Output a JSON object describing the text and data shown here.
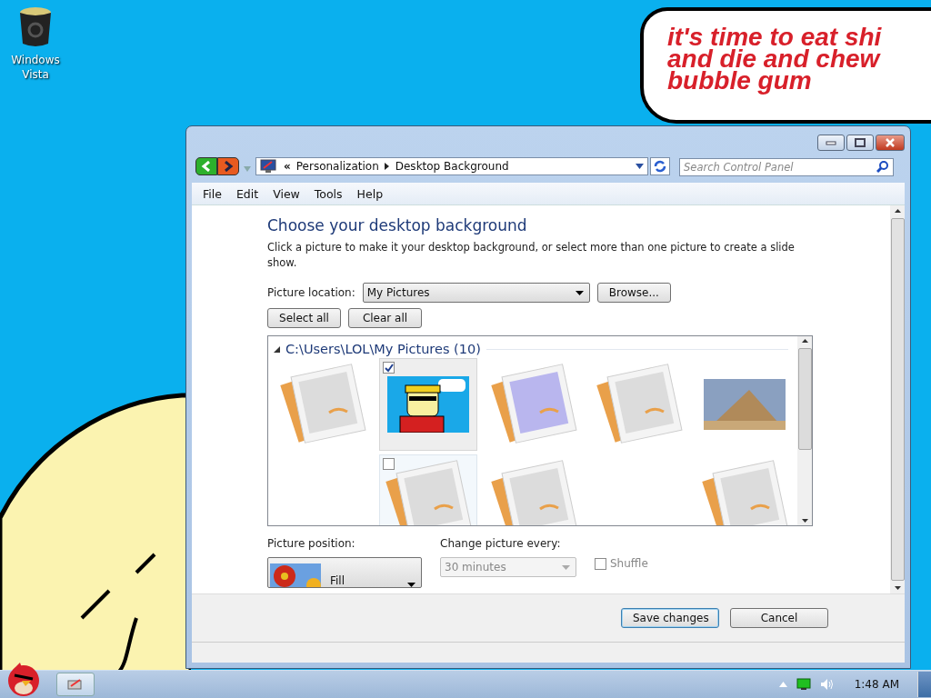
{
  "desktop": {
    "icons": [
      {
        "label": "Windows Vista"
      }
    ],
    "wallpaper_text": [
      "it's time to eat shi",
      "and die and chew",
      "bubble gum"
    ]
  },
  "window": {
    "nav": {
      "breadcrumb": [
        "Personalization",
        "Desktop Background"
      ],
      "separator": "«",
      "search": {
        "placeholder": "Search Control Panel"
      }
    },
    "menu": [
      "File",
      "Edit",
      "View",
      "Tools",
      "Help"
    ],
    "heading": "Choose your desktop background",
    "description": "Click a picture to make it your desktop background, or select more than one picture to create a slide show.",
    "location": {
      "label": "Picture location:",
      "value": "My Pictures",
      "browse": "Browse..."
    },
    "buttons": [
      "Select all",
      "Clear all"
    ],
    "gallery": {
      "group": "C:\\Users\\LOL\\My Pictures (10)",
      "pictures": [
        {
          "kind": "generic",
          "checked": false,
          "hovered": false
        },
        {
          "kind": "comic",
          "checked": true,
          "hovered": false
        },
        {
          "kind": "blue",
          "checked": false,
          "hovered": false
        },
        {
          "kind": "generic",
          "checked": false,
          "hovered": false
        },
        {
          "kind": "pyramid",
          "checked": false,
          "hovered": false
        },
        {
          "kind": "generic",
          "checked": false,
          "hovered": true
        },
        {
          "kind": "generic",
          "checked": false,
          "hovered": false
        },
        {
          "kind": "generic",
          "checked": false,
          "hovered": false
        }
      ]
    },
    "position": {
      "label": "Picture position:",
      "value": "Fill"
    },
    "interval": {
      "label": "Change picture every:",
      "value": "30 minutes",
      "disabled": true
    },
    "shuffle": {
      "label": "Shuffle",
      "checked": false,
      "disabled": true
    },
    "actions": [
      "Save changes",
      "Cancel"
    ]
  },
  "taskbar": {
    "clock": "1:48 AM"
  }
}
